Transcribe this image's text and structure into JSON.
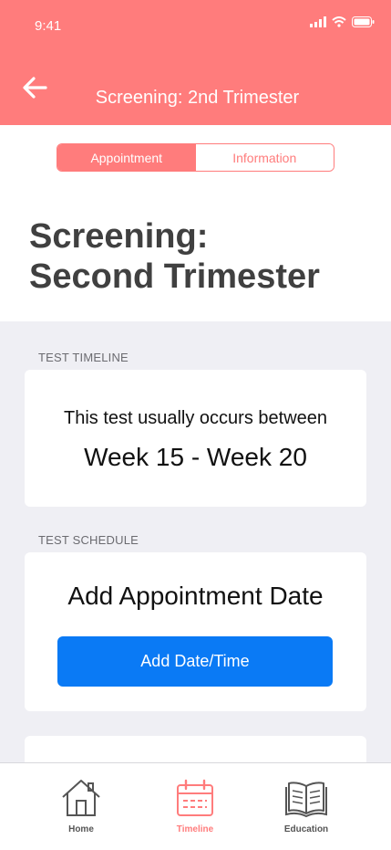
{
  "status_bar": {
    "time": "9:41"
  },
  "header": {
    "title": "Screening: 2nd Trimester"
  },
  "segmented": {
    "tabs": [
      {
        "label": "Appointment"
      },
      {
        "label": "Information"
      }
    ]
  },
  "page": {
    "title_line1": "Screening:",
    "title_line2": "Second Trimester"
  },
  "timeline": {
    "section_label": "TEST TIMELINE",
    "description": "This test usually occurs between",
    "range": "Week 15 - Week 20"
  },
  "schedule": {
    "section_label": "TEST SCHEDULE",
    "heading": "Add Appointment Date",
    "button_label": "Add Date/Time"
  },
  "tabbar": {
    "items": [
      {
        "label": "Home",
        "icon": "house-icon"
      },
      {
        "label": "Timeline",
        "icon": "calendar-icon"
      },
      {
        "label": "Education",
        "icon": "book-icon"
      }
    ]
  },
  "colors": {
    "accent": "#ff7c7c",
    "primary_button": "#0a7af5",
    "background": "#efeff4"
  }
}
